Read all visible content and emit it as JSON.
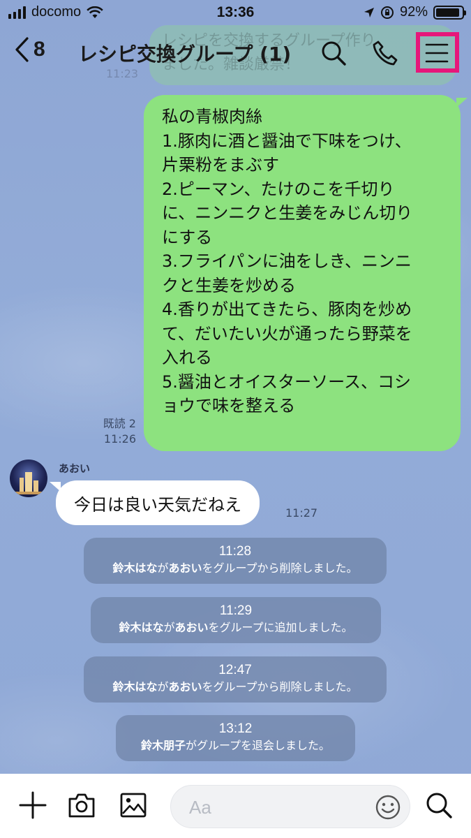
{
  "status_bar": {
    "carrier": "docomo",
    "time": "13:36",
    "battery": "92%",
    "battery_level": 0.92
  },
  "header": {
    "back_count": "8",
    "title": "レシピ交換グループ (1)"
  },
  "ghost_message": {
    "lines": [
      "レシピを交換するグループ作り",
      "ました。雑談厳禁！"
    ],
    "time": "11:23"
  },
  "outgoing_message": {
    "lines": [
      "私の青椒肉絲",
      "1.豚肉に酒と醤油で下味をつけ、",
      "片栗粉をまぶす",
      "2.ピーマン、たけのこを千切り",
      "に、ニンニクと生姜をみじん切り",
      "にする",
      "3.フライパンに油をしき、ニンニ",
      "クと生姜を炒める",
      "4.香りが出てきたら、豚肉を炒め",
      "て、だいたい火が通ったら野菜を",
      "入れる",
      "5.醤油とオイスターソース、コシ",
      "ョウで味を整える"
    ],
    "read_label": "既読 2",
    "time": "11:26"
  },
  "incoming_message": {
    "sender": "あおい",
    "text": "今日は良い天気だねえ",
    "time": "11:27"
  },
  "notices": [
    {
      "time": "11:28",
      "actor": "鈴木はな",
      "connector": "が",
      "target": "あおい",
      "action": "をグループから削除しました。"
    },
    {
      "time": "11:29",
      "actor": "鈴木はな",
      "connector": "が",
      "target": "あおい",
      "action": "をグループに追加しました。"
    },
    {
      "time": "12:47",
      "actor": "鈴木はな",
      "connector": "が",
      "target": "あおい",
      "action": "をグループから削除しました。"
    },
    {
      "time": "13:12",
      "actor": "鈴木朋子",
      "connector": "",
      "target": "",
      "action": "がグループを退会しました。"
    }
  ],
  "input_bar": {
    "placeholder": "Aa"
  },
  "icons": {
    "header": [
      "chevron-left-icon",
      "search-icon",
      "phone-icon",
      "menu-icon"
    ],
    "input_bar": [
      "plus-icon",
      "camera-icon",
      "image-icon",
      "emoji-icon",
      "search-icon"
    ]
  },
  "colors": {
    "background": "#8fa8d6",
    "outgoing_bubble": "#8de27f",
    "incoming_bubble": "#ffffff",
    "notice_bg": "#7084a8",
    "highlight": "#e6177a"
  }
}
